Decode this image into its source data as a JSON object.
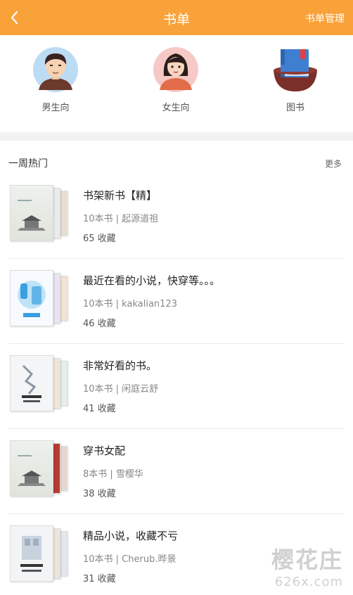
{
  "header": {
    "title": "书单",
    "manage_label": "书单管理",
    "back_icon": "chevron-left-icon"
  },
  "categories": [
    {
      "label": "男生向",
      "icon": "male-avatar-icon"
    },
    {
      "label": "女生向",
      "icon": "female-avatar-icon"
    },
    {
      "label": "图书",
      "icon": "book-icon"
    }
  ],
  "hot": {
    "title": "一周热门",
    "more_label": "更多",
    "items": [
      {
        "name": "书架新书【精】",
        "meta": "10本书 | 起源道祖",
        "fav": "65 收藏"
      },
      {
        "name": "最近在看的小说，快穿等。。。",
        "meta": "10本书 | kakalian123",
        "fav": "46 收藏"
      },
      {
        "name": "非常好看的书。",
        "meta": "10本书 | 闲庭云舒",
        "fav": "41 收藏"
      },
      {
        "name": "穿书女配",
        "meta": "8本书 | 雪樱华",
        "fav": "38 收藏"
      },
      {
        "name": "精品小说，收藏不亏",
        "meta": "10本书 | Cherub.晔景",
        "fav": "31 收藏"
      }
    ]
  },
  "watermark": {
    "line1": "樱花庄",
    "line2": "626x.com"
  },
  "colors": {
    "accent": "#f9a23a"
  }
}
